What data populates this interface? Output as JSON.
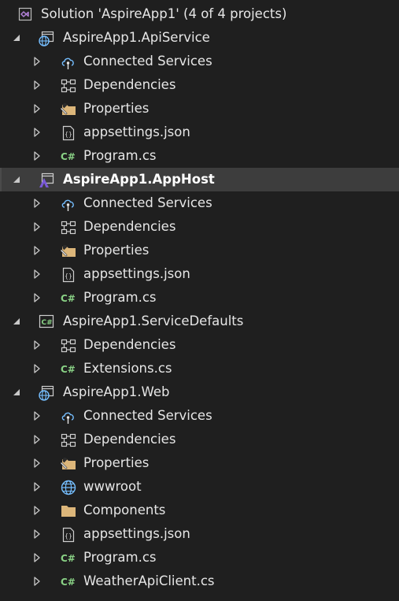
{
  "solution": {
    "label": "Solution 'AspireApp1' (4 of 4 projects)",
    "icon": "visual-studio-solution-icon"
  },
  "projects": [
    {
      "label": "AspireApp1.ApiService",
      "icon": "web-project-icon",
      "items": [
        {
          "label": "Connected Services",
          "icon": "connected-services-icon"
        },
        {
          "label": "Dependencies",
          "icon": "dependencies-icon"
        },
        {
          "label": "Properties",
          "icon": "properties-folder-icon"
        },
        {
          "label": "appsettings.json",
          "icon": "json-file-icon"
        },
        {
          "label": "Program.cs",
          "icon": "csharp-file-icon"
        }
      ]
    },
    {
      "label": "AspireApp1.AppHost",
      "icon": "aspire-host-project-icon",
      "selected": true,
      "items": [
        {
          "label": "Connected Services",
          "icon": "connected-services-icon"
        },
        {
          "label": "Dependencies",
          "icon": "dependencies-icon"
        },
        {
          "label": "Properties",
          "icon": "properties-folder-icon"
        },
        {
          "label": "appsettings.json",
          "icon": "json-file-icon"
        },
        {
          "label": "Program.cs",
          "icon": "csharp-file-icon"
        }
      ]
    },
    {
      "label": "AspireApp1.ServiceDefaults",
      "icon": "csharp-project-icon",
      "items": [
        {
          "label": "Dependencies",
          "icon": "dependencies-icon"
        },
        {
          "label": "Extensions.cs",
          "icon": "csharp-file-icon"
        }
      ]
    },
    {
      "label": "AspireApp1.Web",
      "icon": "web-project-icon",
      "items": [
        {
          "label": "Connected Services",
          "icon": "connected-services-icon"
        },
        {
          "label": "Dependencies",
          "icon": "dependencies-icon"
        },
        {
          "label": "Properties",
          "icon": "properties-folder-icon"
        },
        {
          "label": "wwwroot",
          "icon": "globe-icon"
        },
        {
          "label": "Components",
          "icon": "folder-icon"
        },
        {
          "label": "appsettings.json",
          "icon": "json-file-icon"
        },
        {
          "label": "Program.cs",
          "icon": "csharp-file-icon"
        },
        {
          "label": "WeatherApiClient.cs",
          "icon": "csharp-file-icon"
        }
      ]
    }
  ],
  "colors": {
    "background": "#1f1f1f",
    "selected_row": "#3d3d3d",
    "text": "#e6e6e6",
    "vs_purple": "#b180d7",
    "csharp_green": "#89d185",
    "folder_yellow": "#dcb67a",
    "cloud_blue": "#75beff"
  }
}
